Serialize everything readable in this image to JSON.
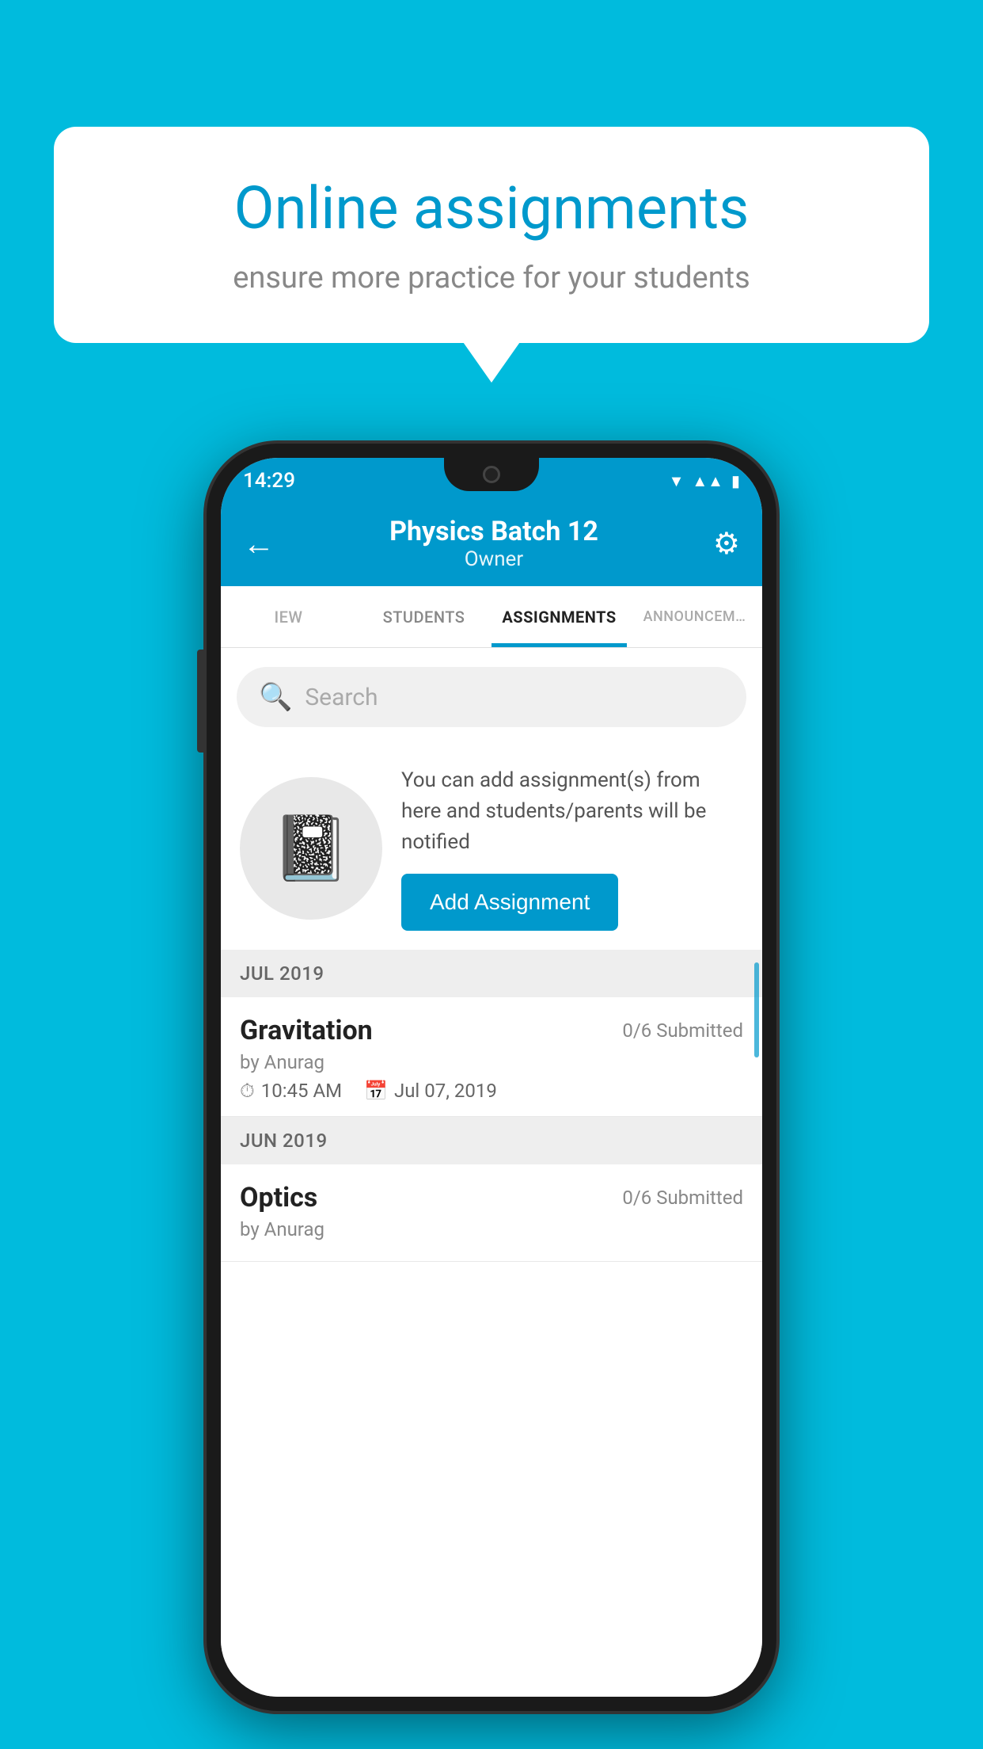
{
  "background": {
    "color": "#00BBDD"
  },
  "speech_bubble": {
    "title": "Online assignments",
    "subtitle": "ensure more practice for your students"
  },
  "status_bar": {
    "time": "14:29",
    "wifi": "▼",
    "signal": "▲",
    "battery": "▮"
  },
  "app_header": {
    "back_icon": "←",
    "title": "Physics Batch 12",
    "subtitle": "Owner",
    "settings_icon": "⚙"
  },
  "tabs": [
    {
      "label": "IEW",
      "active": false
    },
    {
      "label": "STUDENTS",
      "active": false
    },
    {
      "label": "ASSIGNMENTS",
      "active": true
    },
    {
      "label": "ANNOUNCEM…",
      "active": false
    }
  ],
  "search": {
    "placeholder": "Search",
    "icon": "🔍"
  },
  "info_panel": {
    "description": "You can add assignment(s) from here and students/parents will be notified",
    "button_label": "Add Assignment"
  },
  "sections": [
    {
      "header": "JUL 2019",
      "assignments": [
        {
          "name": "Gravitation",
          "submitted": "0/6 Submitted",
          "by": "by Anurag",
          "time": "10:45 AM",
          "date": "Jul 07, 2019"
        }
      ]
    },
    {
      "header": "JUN 2019",
      "assignments": [
        {
          "name": "Optics",
          "submitted": "0/6 Submitted",
          "by": "by Anurag",
          "time": "",
          "date": ""
        }
      ]
    }
  ]
}
